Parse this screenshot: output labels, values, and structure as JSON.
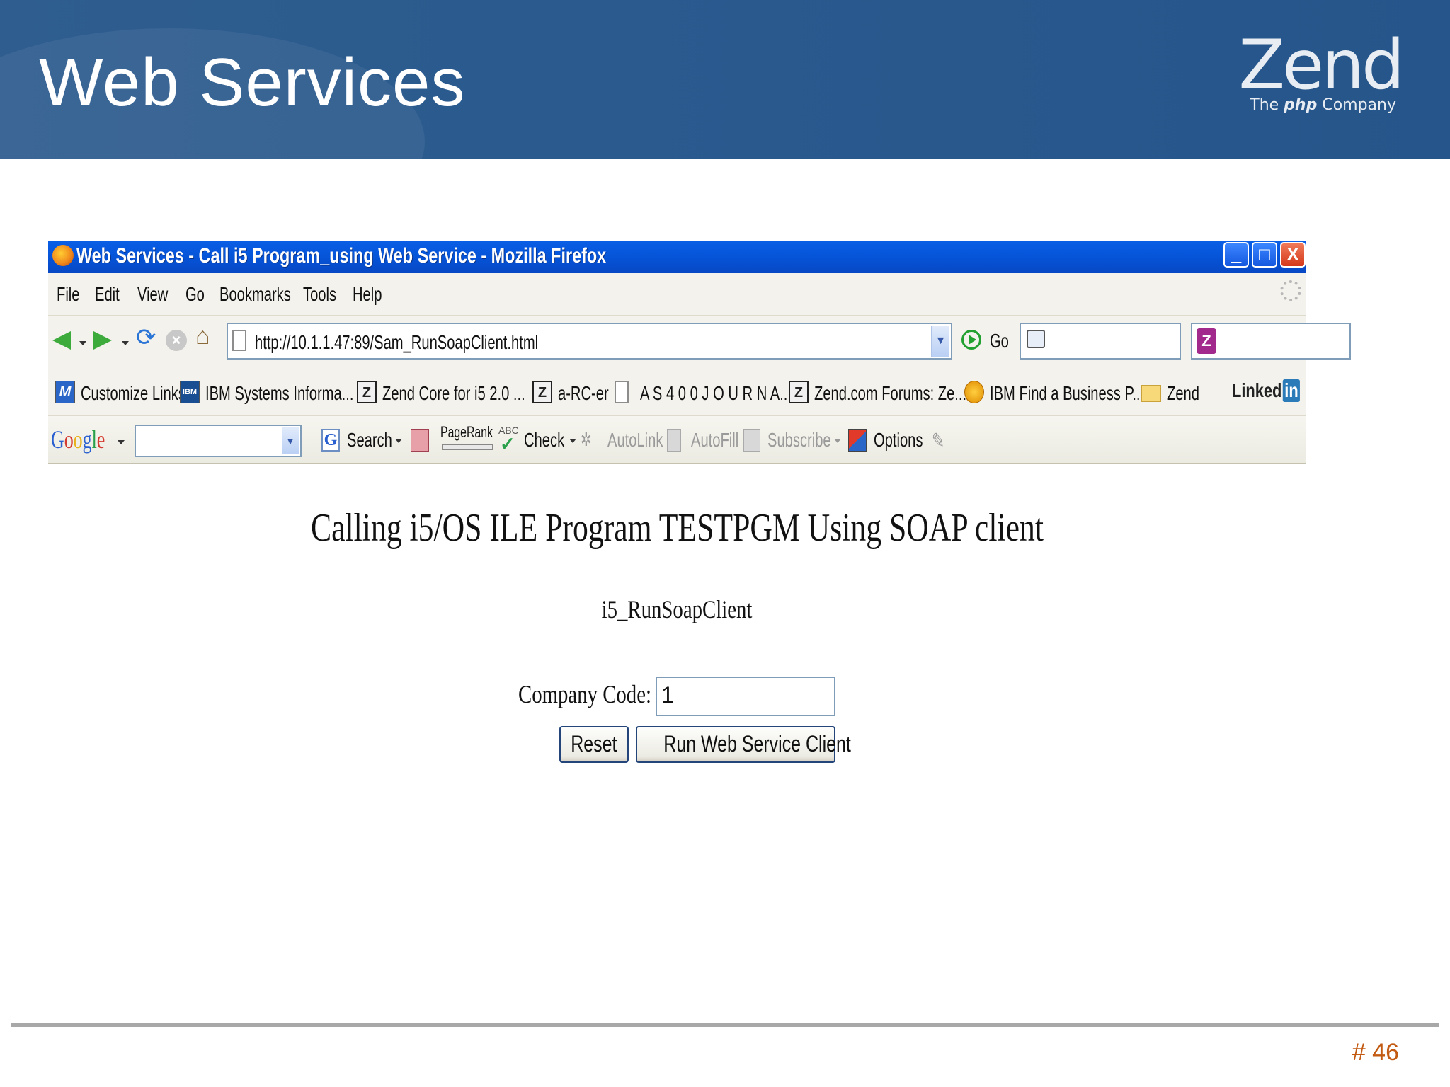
{
  "slide": {
    "title": "Web Services",
    "logo": {
      "word": "Zend",
      "tagline_pre": "The ",
      "tagline_em": "php",
      "tagline_post": " Company"
    },
    "page_number": "# 46",
    "colors": {
      "header_bg": "#2a5a8e",
      "page_number": "#c25a12"
    }
  },
  "browser": {
    "window_title": "Web Services - Call i5 Program_using Web Service - Mozilla Firefox",
    "window_controls": {
      "minimize": "_",
      "maximize": "□",
      "close": "X"
    },
    "menu": [
      "File",
      "Edit",
      "View",
      "Go",
      "Bookmarks",
      "Tools",
      "Help"
    ],
    "address": "http://10.1.1.47:89/Sam_RunSoapClient.html",
    "go_label": "Go",
    "bookmarks": [
      {
        "label": "Customize Links",
        "icon": "customize-icon",
        "glyph": "M"
      },
      {
        "label": "IBM Systems Informa...",
        "icon": "ibm-icon",
        "glyph": "IBM"
      },
      {
        "label": "Zend Core for i5 2.0 ...",
        "icon": "zend-icon",
        "glyph": "Z"
      },
      {
        "label": "a-RC-er",
        "icon": "zend-icon",
        "glyph": "Z"
      },
      {
        "label": "A S 4 0 0 J O U R N A...",
        "icon": "page-icon",
        "glyph": ""
      },
      {
        "label": "Zend.com Forums: Ze...",
        "icon": "zend-icon",
        "glyph": "Z"
      },
      {
        "label": "IBM Find a Business P...",
        "icon": "coin-icon",
        "glyph": ""
      },
      {
        "label": "Zend",
        "icon": "folder-icon",
        "glyph": ""
      }
    ],
    "linkedin": {
      "text": "Linked",
      "in": "in"
    },
    "google_toolbar": {
      "logo": "Google",
      "search_label": "Search",
      "pagerank_label": "PageRank",
      "abc_label": "ABC",
      "check_label": "Check",
      "autolink_label": "AutoLink",
      "autofill_label": "AutoFill",
      "subscribe_label": "Subscribe",
      "options_label": "Options"
    }
  },
  "page": {
    "heading": "Calling i5/OS ILE Program TESTPGM Using SOAP client",
    "form_title": "i5_RunSoapClient",
    "company_code_label": "Company Code:",
    "company_code_value": "1",
    "reset_label": "Reset",
    "run_label": "Run Web Service Client"
  }
}
